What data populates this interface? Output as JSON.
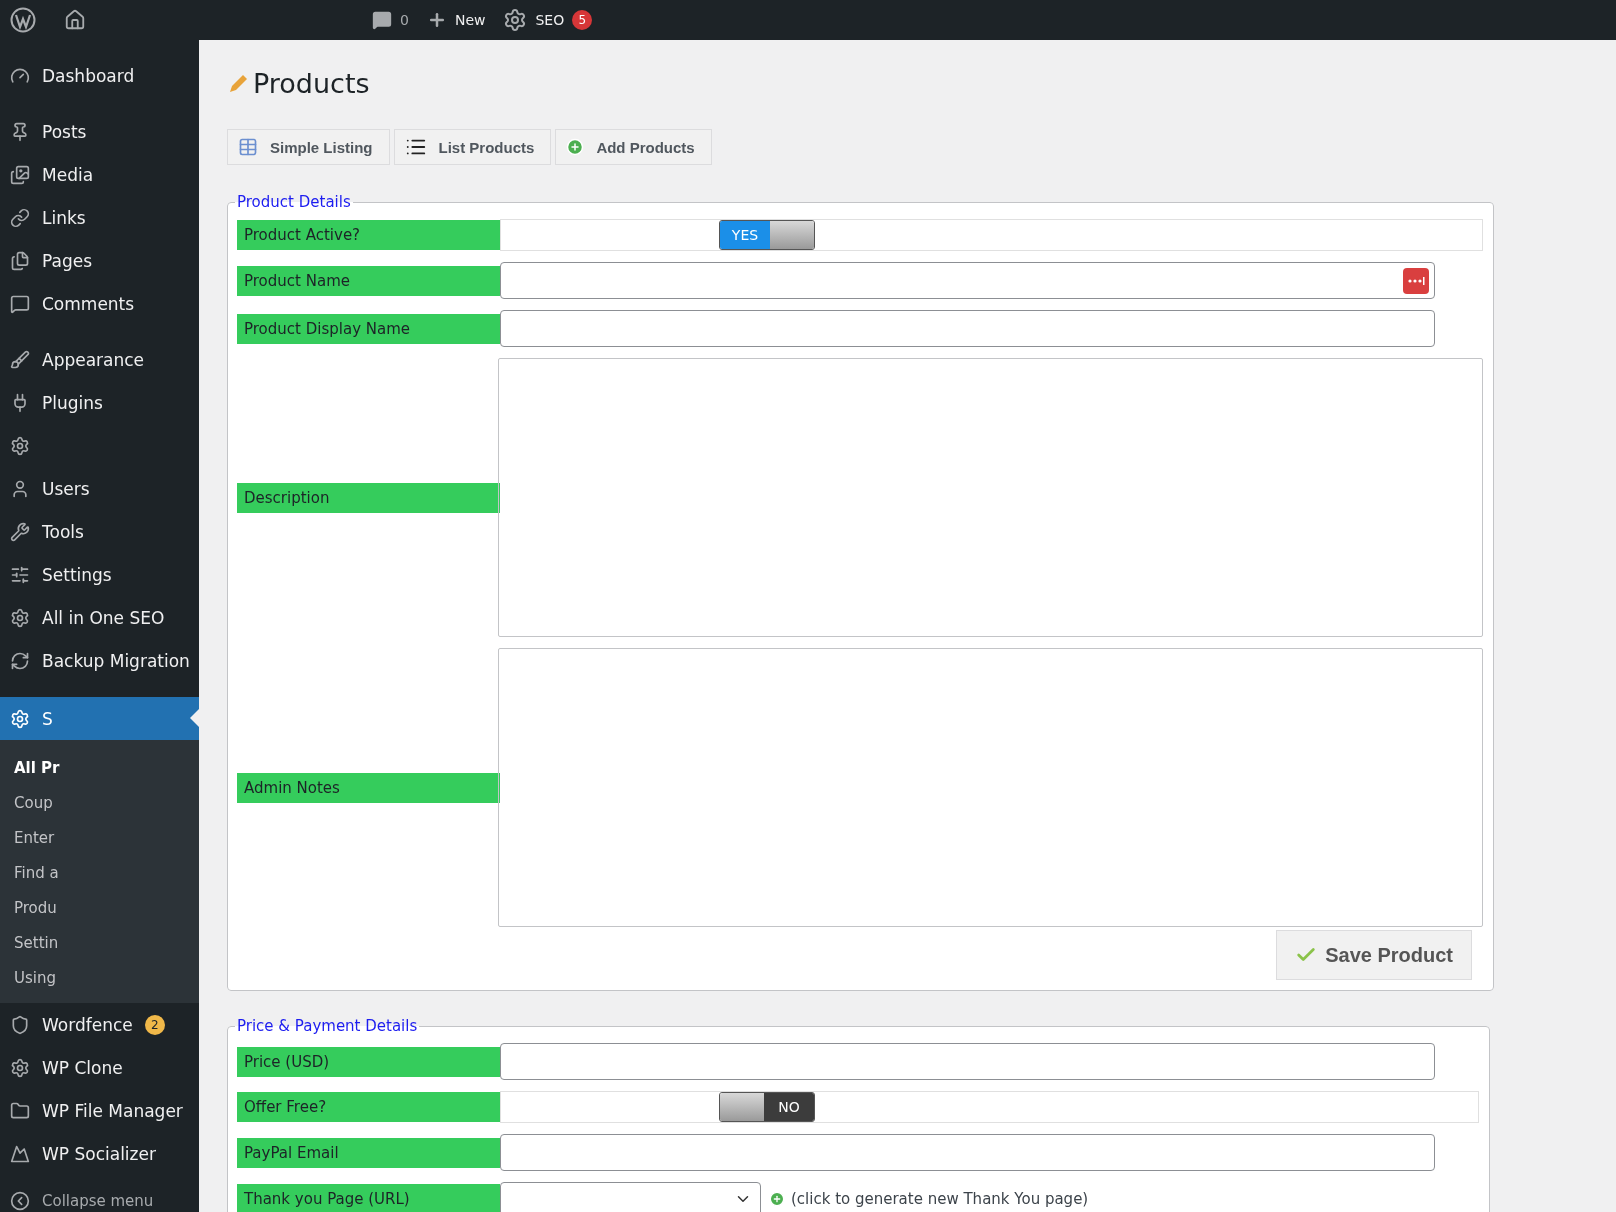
{
  "admin_bar": {
    "comments_count": "0",
    "new_label": "New",
    "seo_label": "SEO",
    "seo_badge": "5"
  },
  "sidebar": {
    "items": [
      {
        "kind": "item",
        "label": "Dashboard",
        "selected": false
      },
      {
        "kind": "separator"
      },
      {
        "kind": "item",
        "label": "Posts",
        "selected": false
      },
      {
        "kind": "item",
        "label": "Media",
        "selected": false
      },
      {
        "kind": "item",
        "label": "Links",
        "selected": false
      },
      {
        "kind": "item",
        "label": "Pages",
        "selected": false
      },
      {
        "kind": "item",
        "label": "Comments",
        "selected": false
      },
      {
        "kind": "separator"
      },
      {
        "kind": "item",
        "label": "Appearance",
        "selected": false
      },
      {
        "kind": "item",
        "label": "Plugins",
        "selected": false
      },
      {
        "kind": "item",
        "selected": false
      },
      {
        "kind": "item",
        "label": "Users",
        "selected": false
      },
      {
        "kind": "item",
        "label": "Tools",
        "selected": false
      },
      {
        "kind": "item",
        "label": "Settings",
        "selected": false
      },
      {
        "kind": "item",
        "label": "All in One SEO",
        "selected": false
      },
      {
        "kind": "item",
        "label": "Backup Migration",
        "selected": false
      },
      {
        "kind": "separator"
      },
      {
        "kind": "item",
        "label": "S",
        "selected": true,
        "children": [
          {
            "label": "All Pr",
            "selected": true
          },
          {
            "label": "Coup",
            "selected": false
          },
          {
            "label": "Enter",
            "selected": false
          },
          {
            "label": "Find a",
            "selected": false
          },
          {
            "label": "Produ",
            "selected": false
          },
          {
            "label": "Settin",
            "selected": false
          },
          {
            "label": "Using",
            "selected": false
          }
        ]
      },
      {
        "kind": "item",
        "label": "Wordfence",
        "badge": "2",
        "selected": false
      },
      {
        "kind": "item",
        "label": "WP Clone",
        "selected": false
      },
      {
        "kind": "item",
        "label": "WP File Manager",
        "selected": false
      },
      {
        "kind": "item",
        "label": "WP Socializer",
        "selected": false
      },
      {
        "kind": "collapse",
        "label": "Collapse menu"
      }
    ]
  },
  "page": {
    "title": "Products",
    "tabs": [
      {
        "label": "Simple Listing"
      },
      {
        "label": "List Products"
      },
      {
        "label": "Add Products"
      }
    ],
    "sections": [
      {
        "legend": "Product Details",
        "rows": [
          {
            "kind": "toggle",
            "label": "Product Active?",
            "on": true,
            "toggle_text": "YES"
          },
          {
            "kind": "text_icon",
            "label": "Product Name"
          },
          {
            "kind": "text",
            "label": "Product Display Name"
          },
          {
            "kind": "textarea",
            "label": "Description"
          },
          {
            "kind": "textarea",
            "label": "Admin Notes"
          }
        ],
        "button": "Save Product"
      },
      {
        "legend": "Price & Payment Details",
        "rows": [
          {
            "kind": "text",
            "label": "Price (USD)"
          },
          {
            "kind": "toggle",
            "label": "Offer Free?",
            "on": false,
            "toggle_text": "NO"
          },
          {
            "kind": "text",
            "label": "PayPal Email"
          },
          {
            "kind": "select",
            "label": "Thank you Page (URL)",
            "link": "(click to generate new Thank You page)"
          }
        ]
      }
    ]
  }
}
